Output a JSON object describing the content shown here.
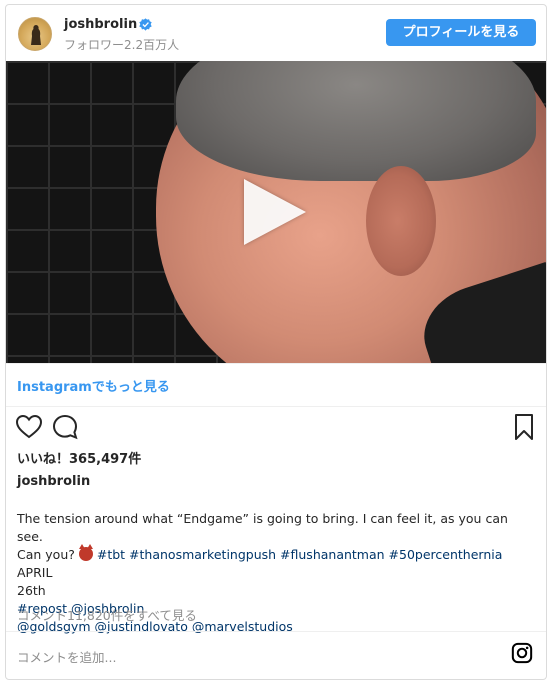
{
  "header": {
    "username": "joshbrolin",
    "followers": "フォロワー2.2百万人",
    "profile_button": "プロフィールを見る"
  },
  "media": {
    "type": "video",
    "more_link": "Instagramでもっと見る"
  },
  "actions": {
    "likes": "いいね！365,497件"
  },
  "post": {
    "author": "joshbrolin",
    "caption_line1": "The tension around what “Endgame” is going to bring. I can feel it, as you can see.",
    "caption_line2a": "Can you?",
    "caption_tags1": "#tbt #thanosmarketingpush #flushanantman #50percenthernia",
    "caption_line2b": " APRIL",
    "caption_line3": "26th",
    "caption_tags2": "#repost @joshbrolin",
    "caption_tags3": "@goldsgym @justindlovato @marvelstudios",
    "comments_link": "コメント11,820件をすべて見る",
    "add_comment_placeholder": "コメントを追加..."
  },
  "colors": {
    "accent": "#3897f0",
    "hashtag": "#003569",
    "muted": "#8e8e8e"
  }
}
